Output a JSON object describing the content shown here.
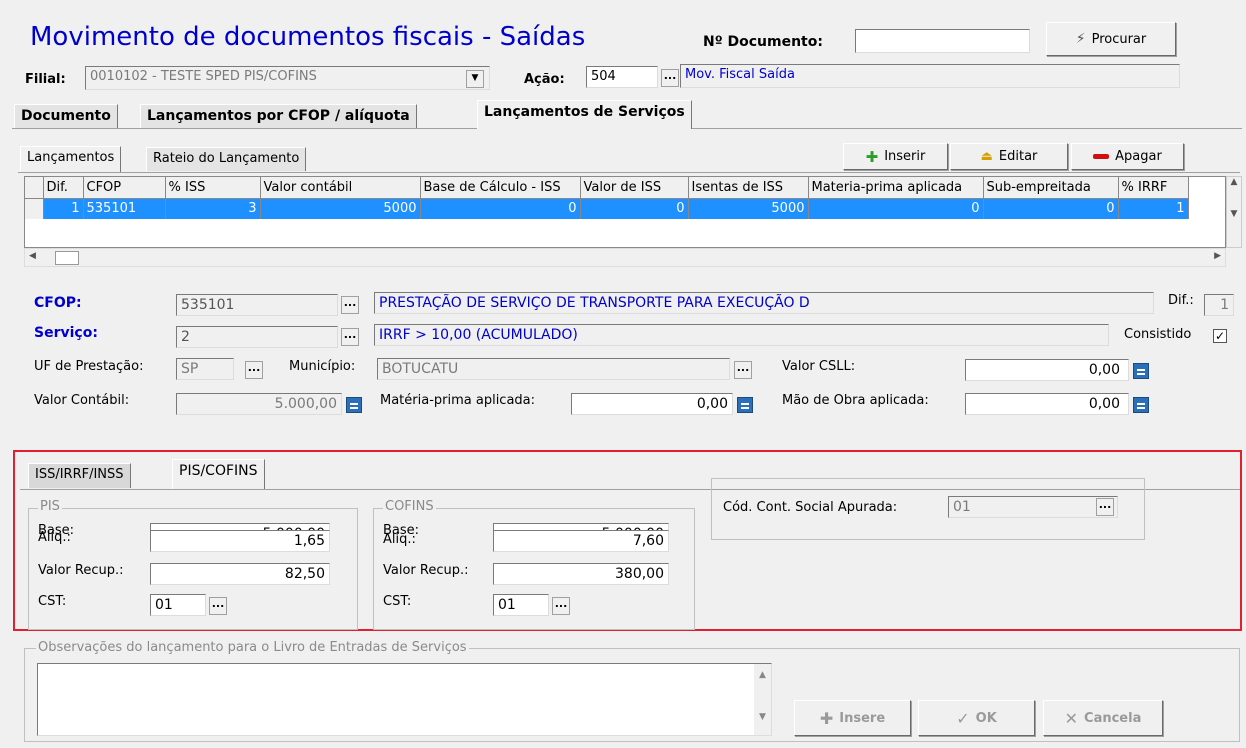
{
  "header": {
    "title": "Movimento de documentos fiscais - Saídas",
    "doc_label": "Nº Documento:",
    "doc_value": "",
    "search_label": "Procurar",
    "filial_label": "Filial:",
    "filial_value": "0010102 - TESTE SPED PIS/COFINS",
    "acao_label": "Ação:",
    "acao_value": "504",
    "acao_desc": "Mov. Fiscal Saída"
  },
  "tabs": [
    {
      "label": "Documento"
    },
    {
      "label": "Lançamentos por CFOP / alíquota"
    },
    {
      "label": "Lançamentos de Serviços"
    }
  ],
  "subtabs": [
    {
      "label": "Lançamentos"
    },
    {
      "label": "Rateio do Lançamento"
    }
  ],
  "toolbar": {
    "insert": "Inserir",
    "edit": "Editar",
    "delete": "Apagar"
  },
  "grid": {
    "columns": [
      "Dif.",
      "CFOP",
      "% ISS",
      "Valor contábil",
      "Base de Cálculo - ISS",
      "Valor de ISS",
      "Isentas de ISS",
      "Materia-prima aplicada",
      "Sub-empreitada",
      "% IRRF"
    ],
    "rows": [
      [
        "1",
        "535101",
        "3",
        "5000",
        "0",
        "0",
        "5000",
        "0",
        "0",
        "1"
      ]
    ]
  },
  "form": {
    "cfop_label": "CFOP:",
    "cfop_value": "535101",
    "cfop_desc": "PRESTAÇÃO DE SERVIÇO DE TRANSPORTE PARA EXECUÇÃO D",
    "dif_label": "Dif.:",
    "dif_value": "1",
    "servico_label": "Serviço:",
    "servico_value": "2",
    "servico_desc": "IRRF > 10,00 (ACUMULADO)",
    "consistido_label": "Consistido",
    "uf_label": "UF de Prestação:",
    "uf_value": "SP",
    "municipio_label": "Município:",
    "municipio_value": "BOTUCATU",
    "csll_label": "Valor CSLL:",
    "csll_value": "0,00",
    "contabil_label": "Valor Contábil:",
    "contabil_value": "5.000,00",
    "materia_label": "Matéria-prima aplicada:",
    "materia_value": "0,00",
    "mao_label": "Mão de Obra aplicada:",
    "mao_value": "0,00"
  },
  "innertabs": [
    {
      "label": "ISS/IRRF/INSS"
    },
    {
      "label": "PIS/COFINS"
    }
  ],
  "pis": {
    "title": "PIS",
    "base_label": "Base:",
    "base_value": "5.000,00",
    "aliq_label": "Alíq.:",
    "aliq_value": "1,65",
    "valor_label": "Valor Recup.:",
    "valor_value": "82,50",
    "cst_label": "CST:",
    "cst_value": "01"
  },
  "cofins": {
    "title": "COFINS",
    "base_label": "Base:",
    "base_value": "5.000,00",
    "aliq_label": "Alíq.:",
    "aliq_value": "7,60",
    "valor_label": "Valor Recup.:",
    "valor_value": "380,00",
    "cst_label": "CST:",
    "cst_value": "01"
  },
  "social": {
    "label": "Cód. Cont. Social Apurada:",
    "value": "01"
  },
  "obs": {
    "title": "Observações do lançamento para o Livro de Entradas de Serviços",
    "value": ""
  },
  "bottom": {
    "insere": "Insere",
    "ok": "OK",
    "cancela": "Cancela"
  },
  "colors": {
    "title_blue": "#0000cc",
    "selection": "#1e90ff",
    "highlight_border": "#e02030"
  }
}
